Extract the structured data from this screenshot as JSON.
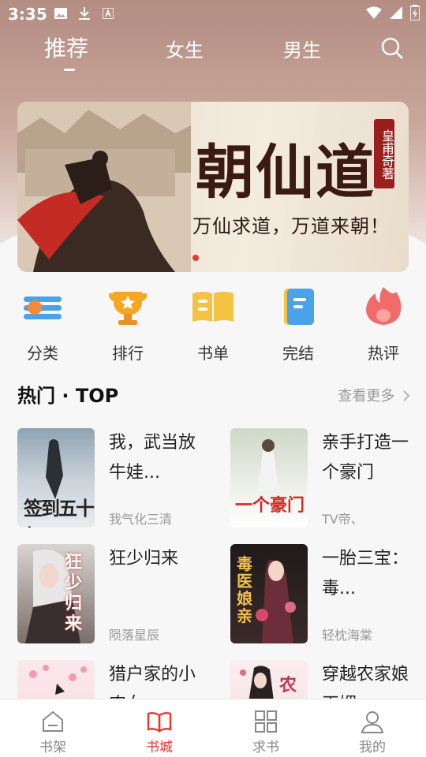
{
  "status_bar": {
    "time": "3:35",
    "left_icons": [
      "image-icon",
      "download-icon",
      "font-icon"
    ],
    "right_icons": [
      "wifi-icon",
      "signal-icon",
      "battery-icon"
    ]
  },
  "top_tabs": [
    {
      "label": "推荐",
      "active": true
    },
    {
      "label": "女生",
      "active": false
    },
    {
      "label": "男生",
      "active": false
    }
  ],
  "banner": {
    "title": "朝仙道",
    "author_seal": "皇甫奇著",
    "subtitle": "万仙求道，万道来朝！"
  },
  "categories": [
    {
      "label": "分类",
      "icon": "category-icon",
      "color": "#4aa3e8"
    },
    {
      "label": "排行",
      "icon": "trophy-icon",
      "color": "#f5a623"
    },
    {
      "label": "书单",
      "icon": "book-list-icon",
      "color": "#f5c242"
    },
    {
      "label": "完结",
      "icon": "completed-book-icon",
      "color": "#4aa3e8"
    },
    {
      "label": "热评",
      "icon": "flame-icon",
      "color": "#f26b6b"
    }
  ],
  "hot_section": {
    "title": "热门 · TOP",
    "see_more": "查看更多",
    "books": [
      {
        "title": "我，武当放牛娃...",
        "author": "我气化三清",
        "cover_text": "签到五十年"
      },
      {
        "title": "亲手打造一个豪门",
        "author": "TV帝、",
        "cover_text": "一个豪门"
      },
      {
        "title": "狂少归来",
        "author": "陨落星辰",
        "cover_text": "狂少归来"
      },
      {
        "title": "一胎三宝：毒...",
        "author": "轻枕海棠",
        "cover_text": "毒医娘亲"
      },
      {
        "title": "猎户家的小农女",
        "author": "",
        "cover_text": ""
      },
      {
        "title": "穿越农家娘巫媚",
        "author": "",
        "cover_text": "农"
      }
    ]
  },
  "bottom_nav": [
    {
      "label": "书架",
      "icon": "bookshelf-icon",
      "active": false
    },
    {
      "label": "书城",
      "icon": "bookstore-icon",
      "active": true
    },
    {
      "label": "求书",
      "icon": "grid-icon",
      "active": false
    },
    {
      "label": "我的",
      "icon": "user-icon",
      "active": false
    }
  ],
  "colors": {
    "accent": "#e8362f",
    "header_bg": "#b38c82"
  }
}
